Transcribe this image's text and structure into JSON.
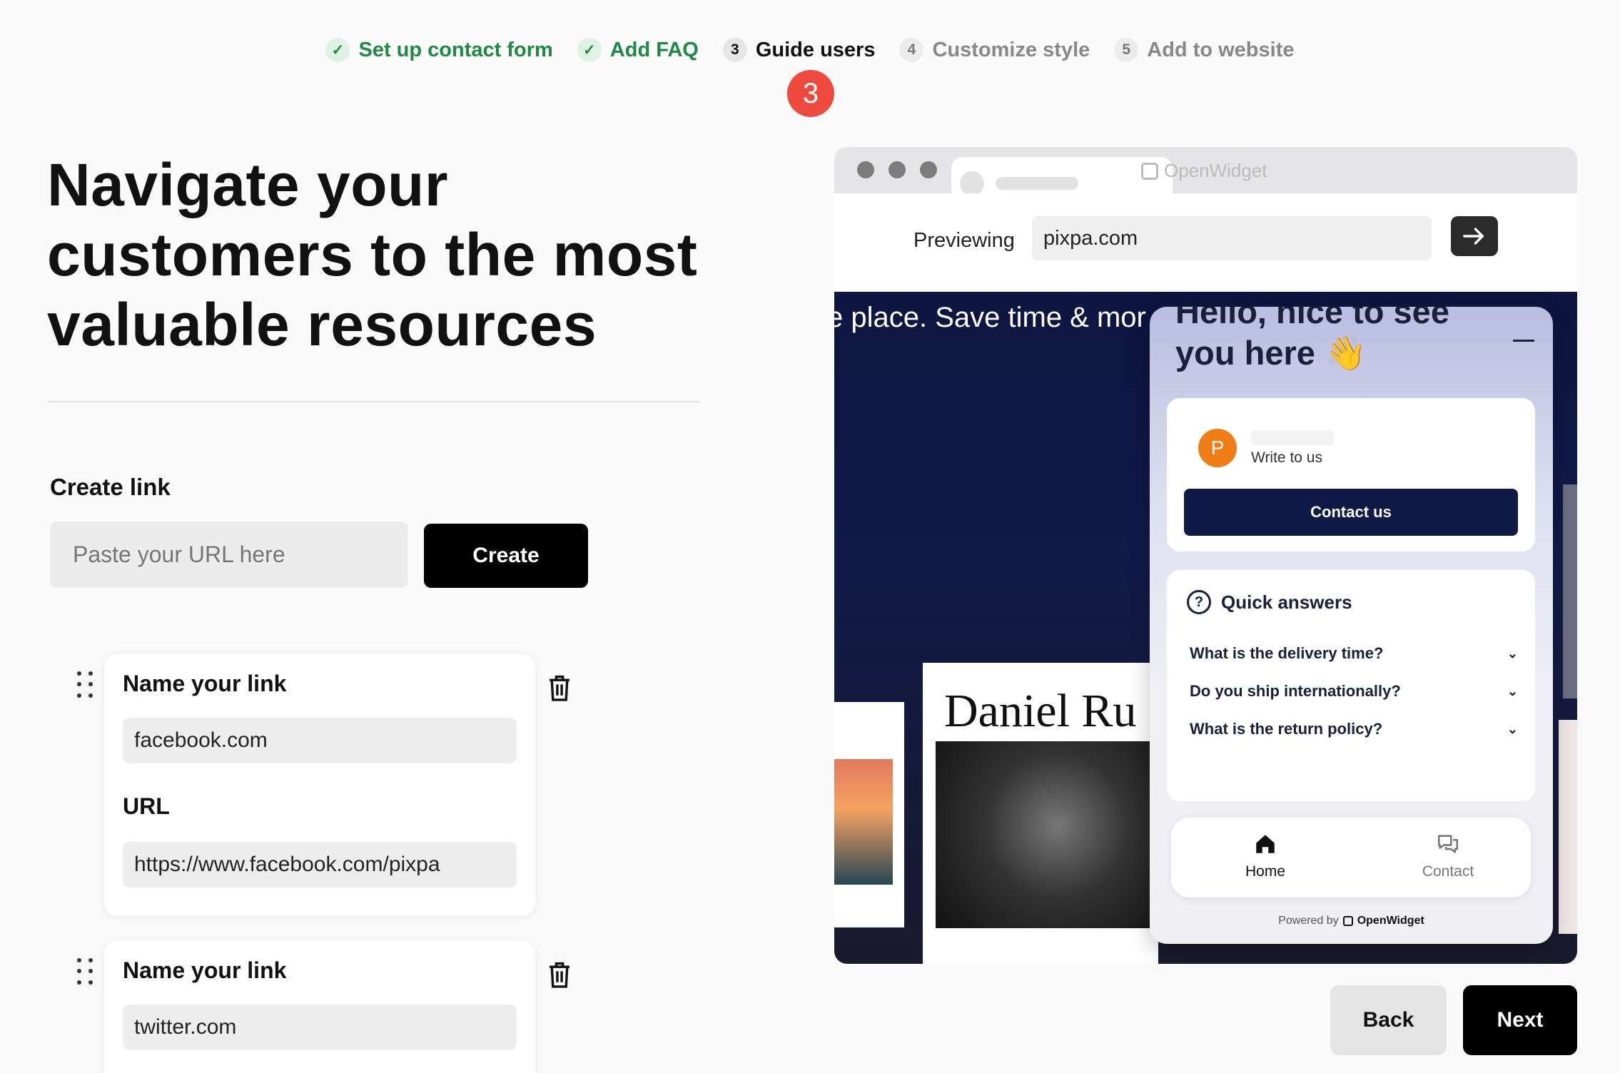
{
  "stepper": {
    "steps": [
      {
        "num": "",
        "label": "Set up contact form",
        "state": "done"
      },
      {
        "num": "",
        "label": "Add FAQ",
        "state": "done"
      },
      {
        "num": "3",
        "label": "Guide users",
        "state": "current"
      },
      {
        "num": "4",
        "label": "Customize style",
        "state": "todo"
      },
      {
        "num": "5",
        "label": "Add to website",
        "state": "todo"
      }
    ],
    "callout": "3"
  },
  "headline": "Navigate your customers to the most valuable resources",
  "create": {
    "label": "Create link",
    "placeholder": "Paste your URL here",
    "button": "Create"
  },
  "links": [
    {
      "name_label": "Name your link",
      "name_value": "facebook.com",
      "url_label": "URL",
      "url_value": "https://www.facebook.com/pixpa"
    },
    {
      "name_label": "Name your link",
      "name_value": "twitter.com"
    }
  ],
  "preview": {
    "brand": "OpenWidget",
    "previewing_label": "Previewing",
    "url": "pixpa.com",
    "site_text": "e place. Save time & mor",
    "portfolio_name": "Daniel Ru"
  },
  "widget": {
    "greeting": "Hello, nice to see you here 👋",
    "avatar_letter": "P",
    "write_to_us": "Write to us",
    "contact_button": "Contact us",
    "quick_answers_title": "Quick answers",
    "faqs": [
      "What is the delivery time?",
      "Do you ship internationally?",
      "What is the return policy?"
    ],
    "nav": {
      "home": "Home",
      "contact": "Contact"
    },
    "powered_by": "Powered by",
    "powered_brand": "OpenWidget"
  },
  "footer": {
    "back": "Back",
    "next": "Next"
  },
  "colors": {
    "done": "#1f8a46",
    "accent_red": "#ee4a3d",
    "widget_navy": "#0f1b46",
    "avatar_orange": "#f07c16"
  }
}
